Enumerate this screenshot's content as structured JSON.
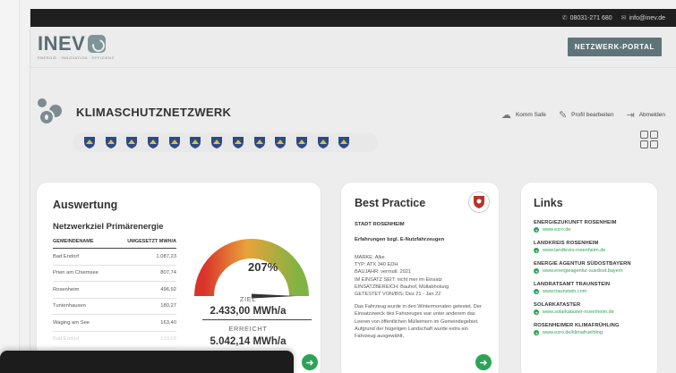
{
  "topbar": {
    "phone": "08031-271 680",
    "email": "info@inev.de"
  },
  "header": {
    "logo_text": "INEV",
    "logo_tagline": "ENERGIE · INNOVATION · EFFIZIENZ",
    "portal_button": "NETZWERK-PORTAL"
  },
  "page": {
    "title": "KLIMASCHUTZNETZWERK",
    "crest_count": 13
  },
  "actions": {
    "komm_safe": "Komm Safe",
    "profil": "Profil bearbeiten",
    "abmelden": "Abmelden"
  },
  "auswertung": {
    "title": "Auswertung",
    "subtitle": "Netzwerkziel Primärenergie",
    "col_name": "GEMEINDENAME",
    "col_value": "UMGESETZT MWH/A",
    "rows": [
      {
        "name": "Bad Endorf",
        "value": "1.087,23"
      },
      {
        "name": "Prien am Chiemsee",
        "value": "807,74"
      },
      {
        "name": "Rosenheim",
        "value": "496,92"
      },
      {
        "name": "Tuntenhausen",
        "value": "180,27"
      },
      {
        "name": "Waging am See",
        "value": "163,40"
      },
      {
        "name": "Bad Endorf",
        "value": "133,63"
      }
    ],
    "gauge_percent": 207,
    "gauge_label": "207%",
    "ziel_label": "ZIEL",
    "ziel_value": "2.433,00 MWh/a",
    "erreicht_label": "ERREICHT",
    "erreicht_value": "5.042,14 MWh/a"
  },
  "best_practice": {
    "title": "Best Practice",
    "city": "STADT ROSENHEIM",
    "heading": "Erfahrungen bzgl. E-Nutzfahrzeugen",
    "details": [
      "MARKE: Alke",
      "TYP: ATX 340 EDH",
      "BAUJAHR: vermutl. 2021",
      "IM EINSATZ SEIT: nicht mer im Einsatz",
      "EINSATZBEREICH: Bauhof, Müllabholung",
      "GETESTET VON/BIS: Dez 21 - Jan 22"
    ],
    "paragraph": "Das Fahrzeug wurde in den Wintermonaten getestet. Der Einsatzzweck des Fahrzeuges war unter anderem das Leeren von öffentlichen Mülleimern im Gemeindegebiet. Aufgrund der hügeligen Landschaft wurde extra ein Fahrzeug ausgewählt,"
  },
  "links": {
    "title": "Links",
    "items": [
      {
        "name": "ENERGIEZUKUNFT ROSENHEIM",
        "url": "www.ezro.de"
      },
      {
        "name": "LANDKREIS ROSENHEIM",
        "url": "www.landkreis-rosenheim.de"
      },
      {
        "name": "ENERGIE AGENTUR SÜDOSTBAYERN",
        "url": "www.energieagentur-suedost.bayern"
      },
      {
        "name": "LANDRATSAMT TRAUNSTEIN",
        "url": "www.traunstein.com"
      },
      {
        "name": "SOLARKATASTER",
        "url": "www.solarkataster-rosenheim.de"
      },
      {
        "name": "ROSENHEIMER KLIMAFRÜHLING",
        "url": "www.ezro.de/klimafruehling"
      }
    ]
  },
  "colors": {
    "accent": "#5e7478",
    "green": "#2ea356",
    "topbar": "#1f1f1f"
  }
}
